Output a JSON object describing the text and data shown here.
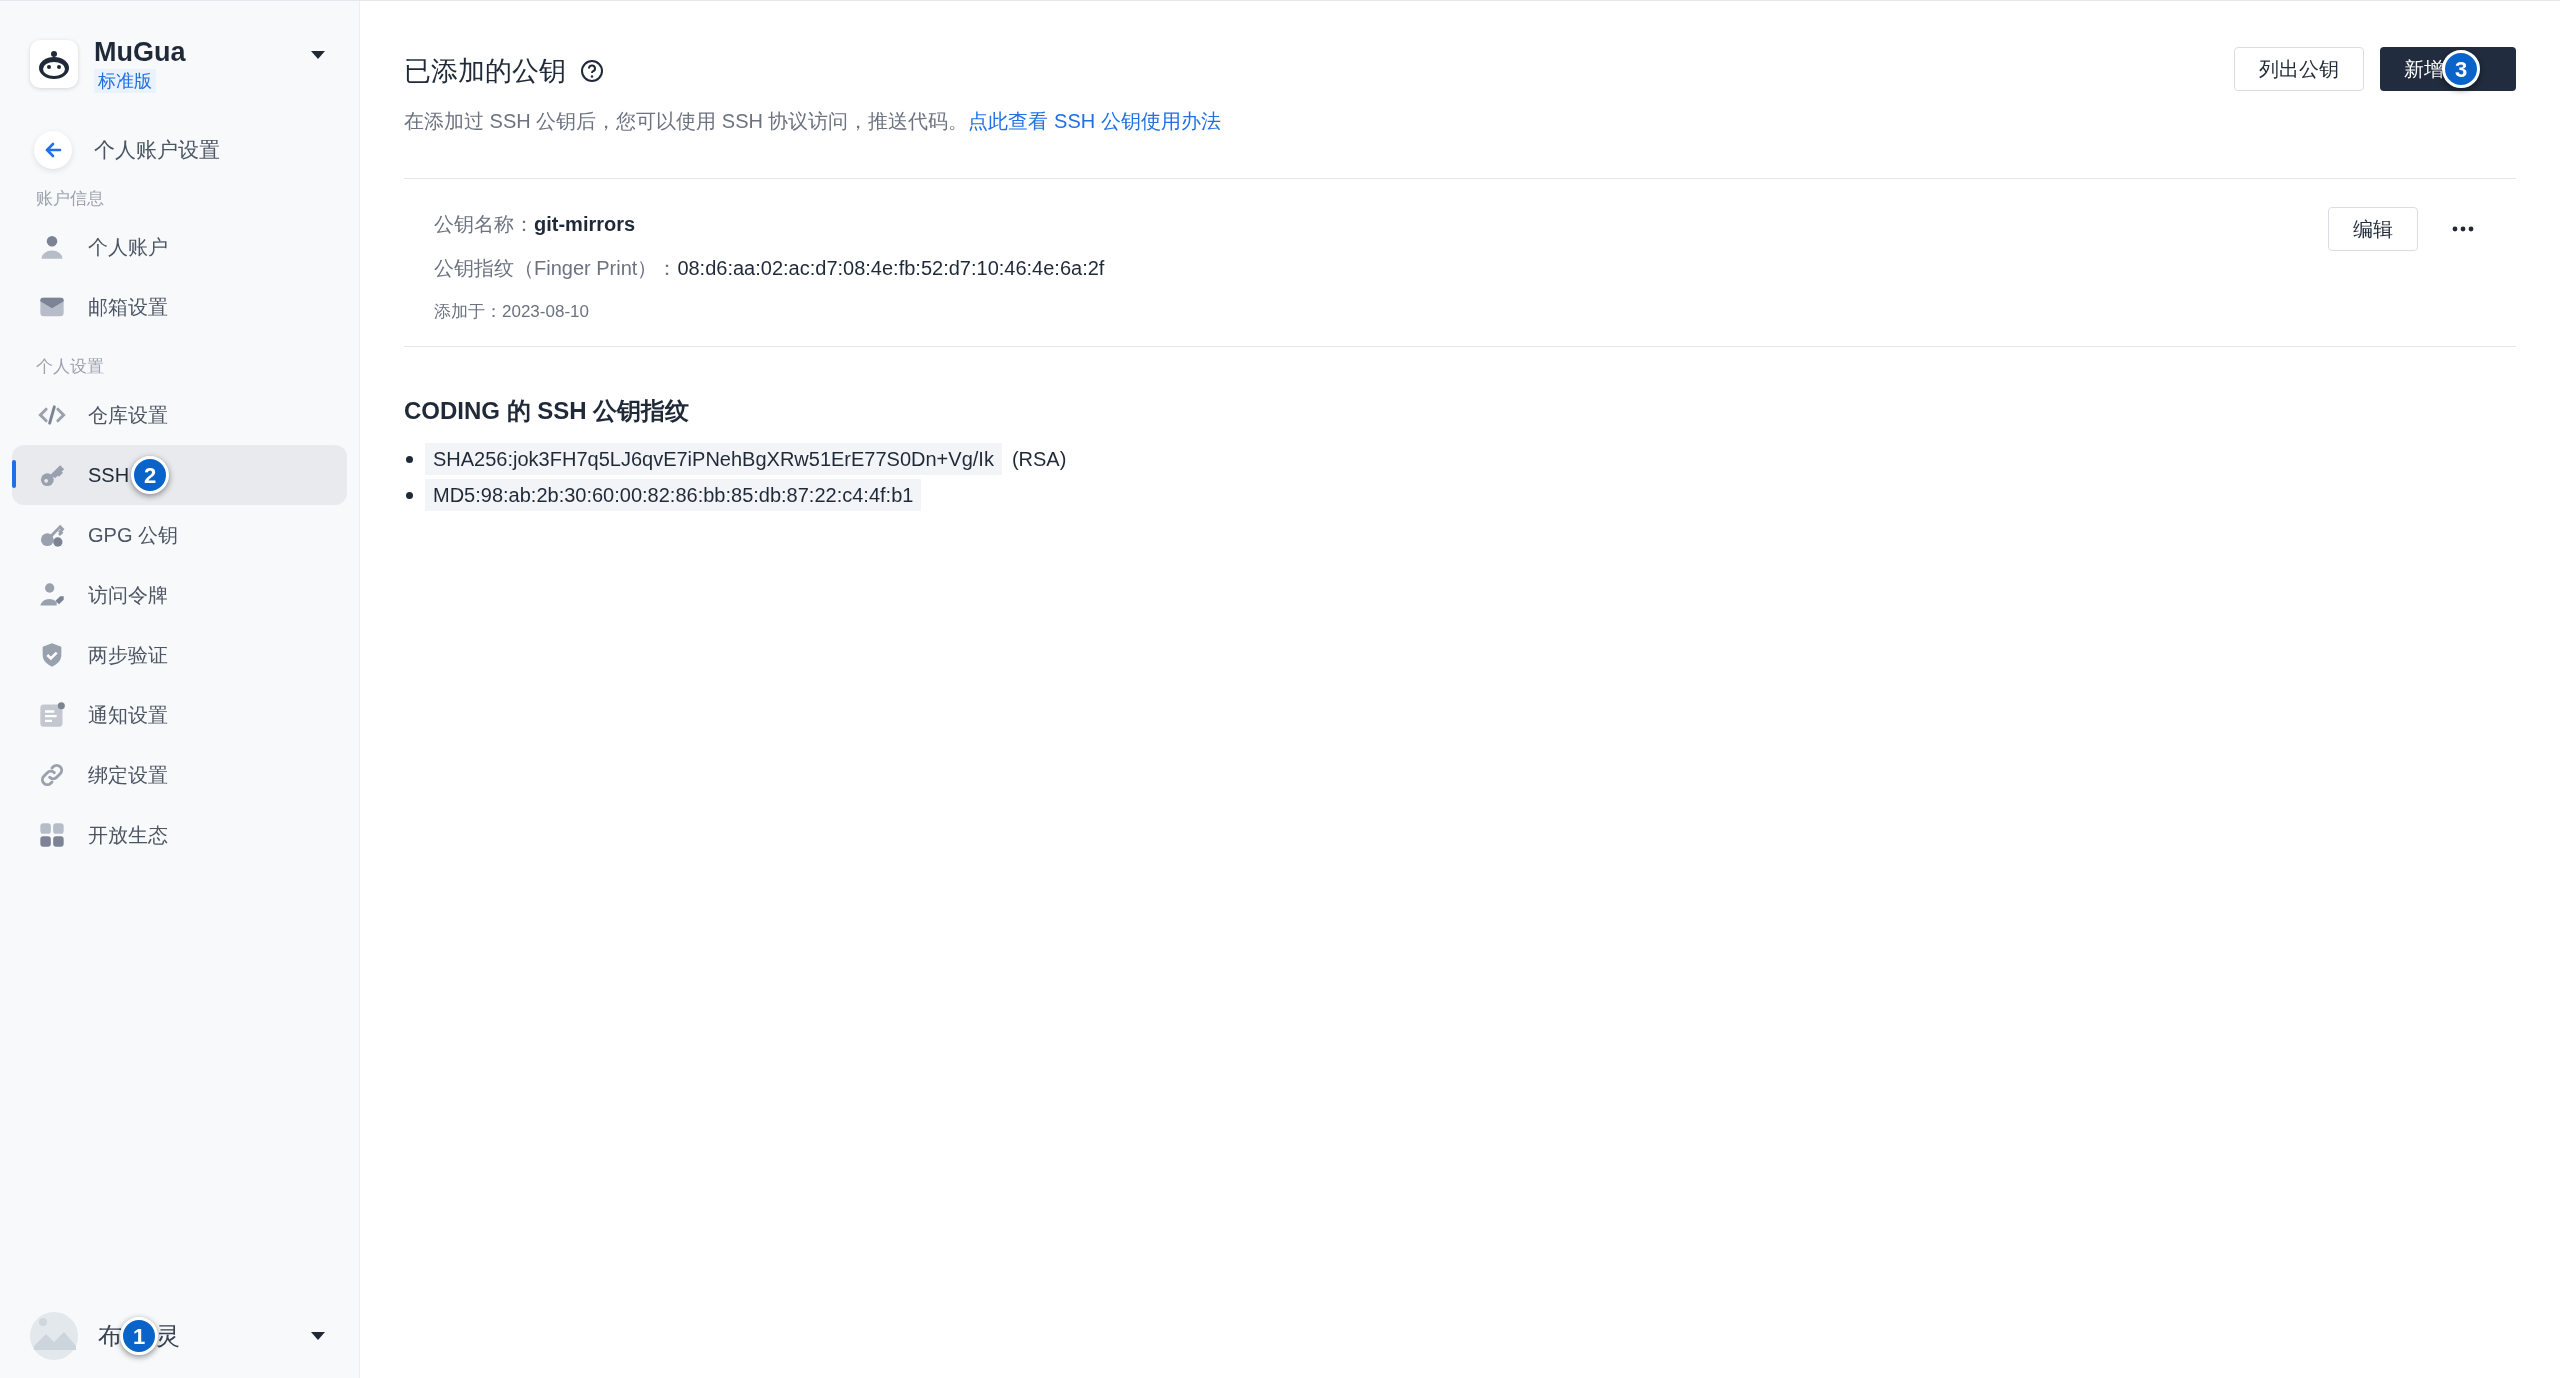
{
  "team": {
    "name": "MuGua",
    "plan": "标准版"
  },
  "back": {
    "label": "个人账户设置"
  },
  "sidebar": {
    "sections": [
      {
        "title": "账户信息",
        "items": [
          {
            "kind": "user",
            "label": "个人账户",
            "selected": false
          },
          {
            "kind": "mail",
            "label": "邮箱设置",
            "selected": false
          }
        ]
      },
      {
        "title": "个人设置",
        "items": [
          {
            "kind": "code",
            "label": "仓库设置",
            "selected": false
          },
          {
            "kind": "key",
            "label": "SSH",
            "badge": "2",
            "selected": true
          },
          {
            "kind": "gpg",
            "label": "GPG 公钥",
            "selected": false
          },
          {
            "kind": "token",
            "label": "访问令牌",
            "selected": false
          },
          {
            "kind": "shield",
            "label": "两步验证",
            "selected": false
          },
          {
            "kind": "notice",
            "label": "通知设置",
            "selected": false
          },
          {
            "kind": "link",
            "label": "绑定设置",
            "selected": false
          },
          {
            "kind": "apps",
            "label": "开放生态",
            "selected": false
          }
        ]
      }
    ]
  },
  "user": {
    "name_start": "布",
    "badge": "1",
    "name_end": "灵"
  },
  "header": {
    "title": "已添加的公钥",
    "description": "在添加过 SSH 公钥后，您可以使用 SSH 协议访问，推送代码。",
    "link": "点此查看 SSH 公钥使用办法",
    "buttons": [
      {
        "kind": "outline",
        "label": "列出公钥"
      },
      {
        "kind": "primary",
        "label": "新增",
        "badge": "3"
      }
    ]
  },
  "keys": [
    {
      "name_label": "公钥名称：",
      "name": "git-mirrors",
      "fingerprint_label": "公钥指纹（Finger Print）：",
      "fingerprint": "08:d6:aa:02:ac:d7:08:4e:fb:52:d7:10:46:4e:6a:2f",
      "added": "添加于：2023-08-10",
      "edit": "编辑"
    }
  ],
  "coding": {
    "title": "CODING 的 SSH 公钥指纹",
    "items": [
      {
        "code": "SHA256:jok3FH7q5LJ6qvE7iPNehBgXRw51ErE77S0Dn+Vg/Ik",
        "suffix": "(RSA)"
      },
      {
        "code": "MD5:98:ab:2b:30:60:00:82:86:bb:85:db:87:22:c4:4f:b1"
      }
    ]
  }
}
